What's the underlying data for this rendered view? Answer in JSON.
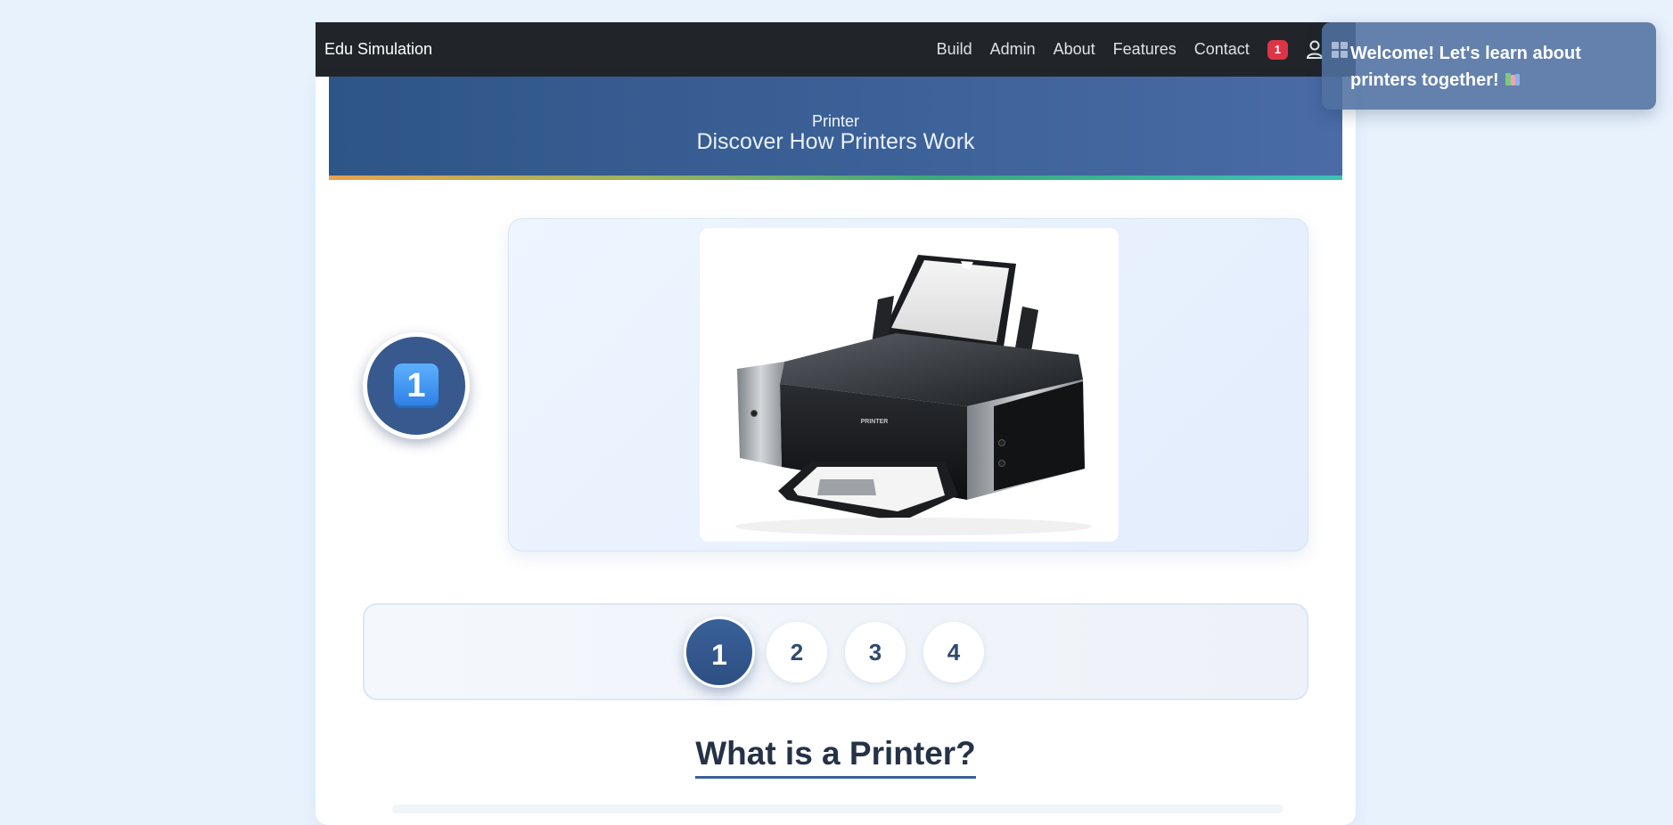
{
  "navbar": {
    "brand": "Edu Simulation",
    "links": [
      "Build",
      "Admin",
      "About",
      "Features",
      "Contact"
    ],
    "notification_count": "1",
    "user_icon": "user-icon"
  },
  "hero": {
    "label": "Printer",
    "title": "Discover How Printers Work"
  },
  "step_indicator": {
    "emoji": "1",
    "icon": "keycap-one-icon"
  },
  "image": {
    "subject": "inkjet printer with paper",
    "printer_label": "PRINTER"
  },
  "steps": {
    "items": [
      "1",
      "2",
      "3",
      "4"
    ],
    "active": "1"
  },
  "section": {
    "title": "What is a Printer?"
  },
  "toast": {
    "message": "Welcome! Let's learn about printers together!",
    "icon": "books-icon",
    "grid_icon": "grid-icon"
  },
  "colors": {
    "page_bg": "#e8f2fd",
    "navbar_bg": "#212529",
    "primary": "#37598e",
    "badge": "#dc3545",
    "title_text": "#253247"
  }
}
